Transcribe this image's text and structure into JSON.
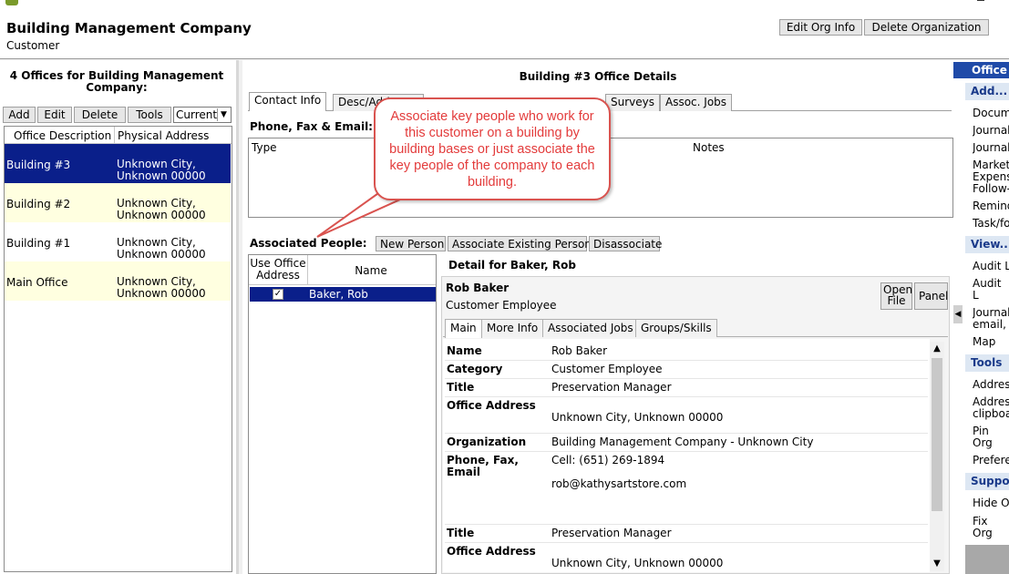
{
  "header": {
    "org_name": "Building Management Company",
    "org_type": "Customer",
    "edit_org_label": "Edit Org Info",
    "delete_org_label": "Delete Organization"
  },
  "offices_panel": {
    "title": "4 Offices for Building Management Company:",
    "toolbar": {
      "add": "Add",
      "edit": "Edit",
      "delete": "Delete",
      "tools": "Tools",
      "filter_value": "Current"
    },
    "columns": [
      "Office Description",
      "Physical Address"
    ],
    "rows": [
      {
        "description": "Building #3",
        "address_line1": "Unknown City,",
        "address_line2": "Unknown   00000",
        "selected": true
      },
      {
        "description": "Building #2",
        "address_line1": "Unknown City,",
        "address_line2": "Unknown   00000",
        "selected": false
      },
      {
        "description": "Building #1",
        "address_line1": "Unknown City,",
        "address_line2": "Unknown   00000",
        "selected": false
      },
      {
        "description": "Main Office",
        "address_line1": "Unknown City,",
        "address_line2": "Unknown   00000",
        "selected": false
      }
    ]
  },
  "office_details": {
    "title": "Building #3 Office Details",
    "tabs": [
      "Contact Info",
      "Desc/Add",
      "Surveys",
      "Assoc. Jobs"
    ],
    "phone_section_label": "Phone, Fax & Email:",
    "phone_columns": [
      "Type",
      "Notes"
    ],
    "associated_people_label": "Associated People:",
    "people_buttons": {
      "new_person": "New Person",
      "associate_existing": "Associate Existing Person",
      "disassociate": "Disassociate"
    },
    "people_columns": [
      "Use Office Address",
      "Name"
    ],
    "people_rows": [
      {
        "use_office_address": true,
        "name": "Baker, Rob"
      }
    ]
  },
  "person_detail": {
    "header": "Detail for Baker, Rob",
    "name": "Rob Baker",
    "category_line": "Customer Employee",
    "open_file_label": "Open File",
    "panel_label": "Panel",
    "tabs": [
      "Main",
      "More Info",
      "Associated Jobs",
      "Groups/Skills"
    ],
    "fields": {
      "name_label": "Name",
      "name_value": "Rob Baker",
      "category_label": "Category",
      "category_value": "Customer Employee",
      "title_label": "Title",
      "title_value": "Preservation Manager",
      "office_address_label": "Office Address",
      "office_address_value": "Unknown City, Unknown   00000",
      "organization_label": "Organization",
      "organization_value": "Building Management Company - Unknown City",
      "phone_label": "Phone, Fax, Email",
      "phone_value": "Cell: (651) 269-1894",
      "email_value": "rob@kathysartstore.com",
      "title2_label": "Title",
      "title2_value": "Preservation Manager",
      "office_address2_label": "Office Address",
      "office_address2_value": "Unknown City, Unknown   00000"
    }
  },
  "callout": {
    "text": "Associate key people who work for this customer on a building by building bases or just associate the key people of the company to each building."
  },
  "sidebar": {
    "header_office": "Office",
    "add_header": "Add...",
    "add_items": [
      "Docum",
      "Journal",
      "Journal",
      "Market Expens Follow-",
      "Remind",
      "Task/fo"
    ],
    "view_header": "View...",
    "view_items": [
      "Audit L",
      "Audit L Compa",
      "Journal email,",
      "Map"
    ],
    "tools_header": "Tools",
    "tools_items": [
      "Addres",
      "Addres clipboa",
      "Pin Org Homep",
      "Prefere"
    ],
    "support_header": "Suppo",
    "support_items": [
      "Hide Or",
      "Fix Org Bridge"
    ]
  },
  "colors": {
    "selection": "#0a1f8a",
    "row_alt": "#ffffe0",
    "callout_red": "#e33b3b",
    "sidebar_header": "#1a3a8a"
  }
}
